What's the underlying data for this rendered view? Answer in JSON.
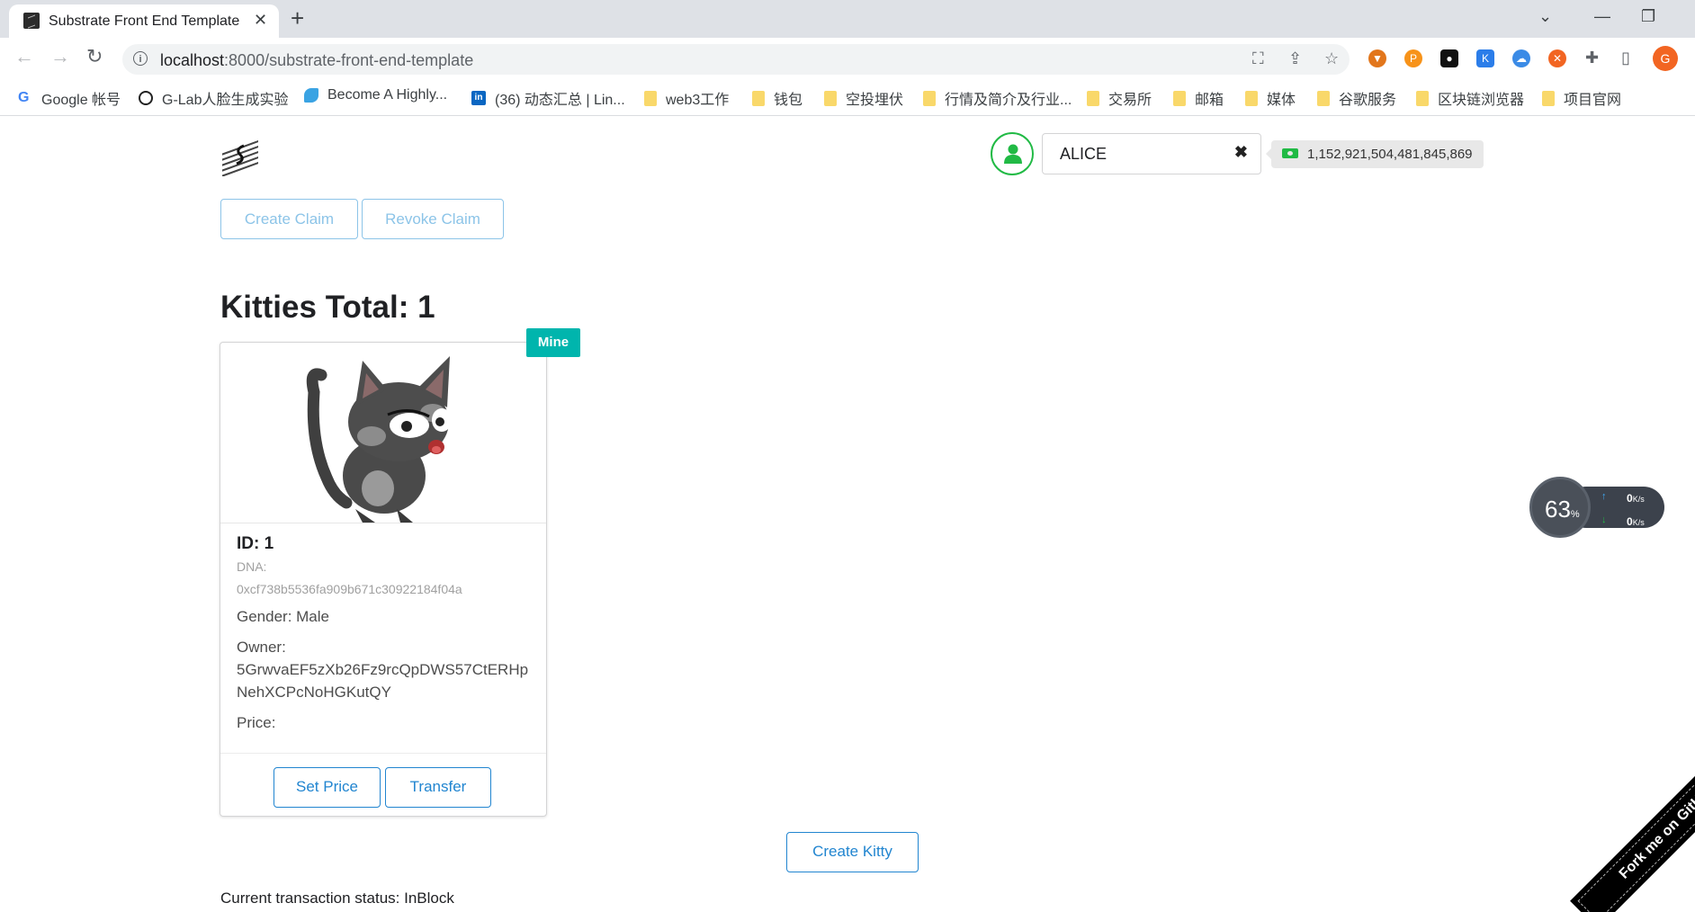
{
  "browser": {
    "tab_title": "Substrate Front End Template",
    "url_host": "localhost",
    "url_rest": ":8000/substrate-front-end-template",
    "bookmarks": [
      {
        "label": "Google 帐号",
        "icon": "google-icon"
      },
      {
        "label": "G-Lab人脸生成实验",
        "icon": "glab-icon"
      },
      {
        "label": "Become A Highly...",
        "icon": "butterfly-icon"
      },
      {
        "label": "(36) 动态汇总 | Lin...",
        "icon": "linkedin-icon"
      },
      {
        "label": "web3工作",
        "icon": "folder-icon"
      },
      {
        "label": "钱包",
        "icon": "folder-icon"
      },
      {
        "label": "空投埋伏",
        "icon": "folder-icon"
      },
      {
        "label": "行情及简介及行业...",
        "icon": "folder-icon"
      },
      {
        "label": "交易所",
        "icon": "folder-icon"
      },
      {
        "label": "邮箱",
        "icon": "folder-icon"
      },
      {
        "label": "媒体",
        "icon": "folder-icon"
      },
      {
        "label": "谷歌服务",
        "icon": "folder-icon"
      },
      {
        "label": "区块链浏览器",
        "icon": "folder-icon"
      },
      {
        "label": "项目官网",
        "icon": "folder-icon"
      }
    ]
  },
  "header": {
    "account_name": "ALICE",
    "balance": "1,152,921,504,481,845,869"
  },
  "claims": {
    "create_label": "Create Claim",
    "revoke_label": "Revoke Claim"
  },
  "kitties": {
    "heading": "Kitties Total: 1",
    "cards": [
      {
        "tag": "Mine",
        "id": "ID: 1",
        "dna_label": "DNA:",
        "dna": "0xcf738b5536fa909b671c30922184f04a",
        "gender": "Gender: Male",
        "owner_label": "Owner:",
        "owner": "5GrwvaEF5zXb26Fz9rcQpDWS57CtERHpNehXCPcNoHGKutQY",
        "price": "Price:",
        "set_price_label": "Set Price",
        "transfer_label": "Transfer"
      }
    ],
    "create_label": "Create Kitty"
  },
  "status": "Current transaction status: InBlock",
  "speed_widget": {
    "percent": "63",
    "percent_unit": "%",
    "upload": "0",
    "download": "0",
    "unit": "K/s"
  },
  "ribbon": "Fork me on GitHub",
  "colors": {
    "accent_blue": "#2185d0",
    "teal_tag": "#00b5ad",
    "green": "#21ba45"
  }
}
